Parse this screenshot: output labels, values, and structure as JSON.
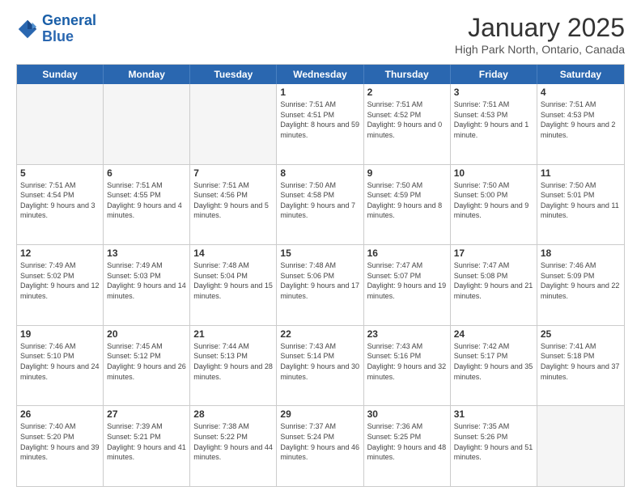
{
  "logo": {
    "line1": "General",
    "line2": "Blue"
  },
  "title": "January 2025",
  "subtitle": "High Park North, Ontario, Canada",
  "days_of_week": [
    "Sunday",
    "Monday",
    "Tuesday",
    "Wednesday",
    "Thursday",
    "Friday",
    "Saturday"
  ],
  "weeks": [
    [
      {
        "day": "",
        "empty": true,
        "text": ""
      },
      {
        "day": "",
        "empty": true,
        "text": ""
      },
      {
        "day": "",
        "empty": true,
        "text": ""
      },
      {
        "day": "1",
        "text": "Sunrise: 7:51 AM\nSunset: 4:51 PM\nDaylight: 8 hours and 59 minutes."
      },
      {
        "day": "2",
        "text": "Sunrise: 7:51 AM\nSunset: 4:52 PM\nDaylight: 9 hours and 0 minutes."
      },
      {
        "day": "3",
        "text": "Sunrise: 7:51 AM\nSunset: 4:53 PM\nDaylight: 9 hours and 1 minute."
      },
      {
        "day": "4",
        "text": "Sunrise: 7:51 AM\nSunset: 4:53 PM\nDaylight: 9 hours and 2 minutes."
      }
    ],
    [
      {
        "day": "5",
        "text": "Sunrise: 7:51 AM\nSunset: 4:54 PM\nDaylight: 9 hours and 3 minutes."
      },
      {
        "day": "6",
        "text": "Sunrise: 7:51 AM\nSunset: 4:55 PM\nDaylight: 9 hours and 4 minutes."
      },
      {
        "day": "7",
        "text": "Sunrise: 7:51 AM\nSunset: 4:56 PM\nDaylight: 9 hours and 5 minutes."
      },
      {
        "day": "8",
        "text": "Sunrise: 7:50 AM\nSunset: 4:58 PM\nDaylight: 9 hours and 7 minutes."
      },
      {
        "day": "9",
        "text": "Sunrise: 7:50 AM\nSunset: 4:59 PM\nDaylight: 9 hours and 8 minutes."
      },
      {
        "day": "10",
        "text": "Sunrise: 7:50 AM\nSunset: 5:00 PM\nDaylight: 9 hours and 9 minutes."
      },
      {
        "day": "11",
        "text": "Sunrise: 7:50 AM\nSunset: 5:01 PM\nDaylight: 9 hours and 11 minutes."
      }
    ],
    [
      {
        "day": "12",
        "text": "Sunrise: 7:49 AM\nSunset: 5:02 PM\nDaylight: 9 hours and 12 minutes."
      },
      {
        "day": "13",
        "text": "Sunrise: 7:49 AM\nSunset: 5:03 PM\nDaylight: 9 hours and 14 minutes."
      },
      {
        "day": "14",
        "text": "Sunrise: 7:48 AM\nSunset: 5:04 PM\nDaylight: 9 hours and 15 minutes."
      },
      {
        "day": "15",
        "text": "Sunrise: 7:48 AM\nSunset: 5:06 PM\nDaylight: 9 hours and 17 minutes."
      },
      {
        "day": "16",
        "text": "Sunrise: 7:47 AM\nSunset: 5:07 PM\nDaylight: 9 hours and 19 minutes."
      },
      {
        "day": "17",
        "text": "Sunrise: 7:47 AM\nSunset: 5:08 PM\nDaylight: 9 hours and 21 minutes."
      },
      {
        "day": "18",
        "text": "Sunrise: 7:46 AM\nSunset: 5:09 PM\nDaylight: 9 hours and 22 minutes."
      }
    ],
    [
      {
        "day": "19",
        "text": "Sunrise: 7:46 AM\nSunset: 5:10 PM\nDaylight: 9 hours and 24 minutes."
      },
      {
        "day": "20",
        "text": "Sunrise: 7:45 AM\nSunset: 5:12 PM\nDaylight: 9 hours and 26 minutes."
      },
      {
        "day": "21",
        "text": "Sunrise: 7:44 AM\nSunset: 5:13 PM\nDaylight: 9 hours and 28 minutes."
      },
      {
        "day": "22",
        "text": "Sunrise: 7:43 AM\nSunset: 5:14 PM\nDaylight: 9 hours and 30 minutes."
      },
      {
        "day": "23",
        "text": "Sunrise: 7:43 AM\nSunset: 5:16 PM\nDaylight: 9 hours and 32 minutes."
      },
      {
        "day": "24",
        "text": "Sunrise: 7:42 AM\nSunset: 5:17 PM\nDaylight: 9 hours and 35 minutes."
      },
      {
        "day": "25",
        "text": "Sunrise: 7:41 AM\nSunset: 5:18 PM\nDaylight: 9 hours and 37 minutes."
      }
    ],
    [
      {
        "day": "26",
        "text": "Sunrise: 7:40 AM\nSunset: 5:20 PM\nDaylight: 9 hours and 39 minutes."
      },
      {
        "day": "27",
        "text": "Sunrise: 7:39 AM\nSunset: 5:21 PM\nDaylight: 9 hours and 41 minutes."
      },
      {
        "day": "28",
        "text": "Sunrise: 7:38 AM\nSunset: 5:22 PM\nDaylight: 9 hours and 44 minutes."
      },
      {
        "day": "29",
        "text": "Sunrise: 7:37 AM\nSunset: 5:24 PM\nDaylight: 9 hours and 46 minutes."
      },
      {
        "day": "30",
        "text": "Sunrise: 7:36 AM\nSunset: 5:25 PM\nDaylight: 9 hours and 48 minutes."
      },
      {
        "day": "31",
        "text": "Sunrise: 7:35 AM\nSunset: 5:26 PM\nDaylight: 9 hours and 51 minutes."
      },
      {
        "day": "",
        "empty": true,
        "text": ""
      }
    ]
  ]
}
